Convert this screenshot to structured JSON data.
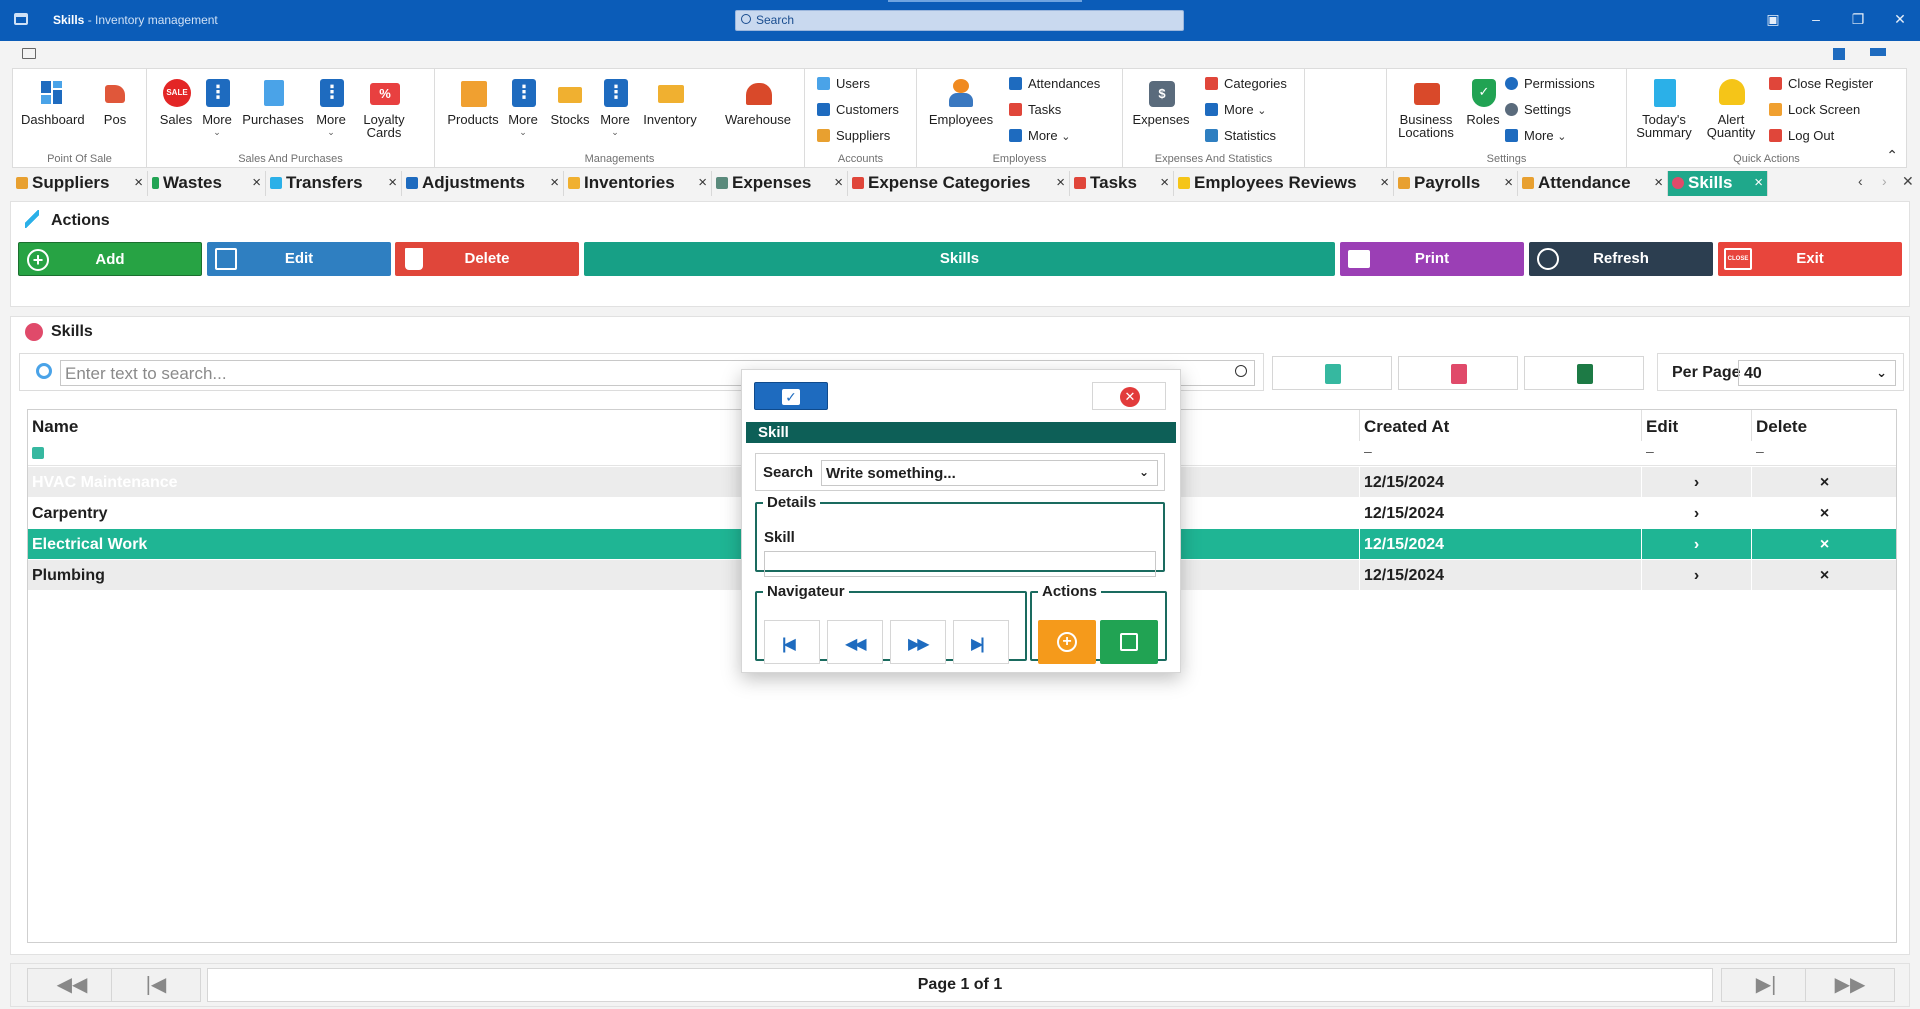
{
  "window": {
    "app_title": "Skills",
    "subtitle": " - Inventory management",
    "search_placeholder": "Search"
  },
  "ribbon": {
    "groups": [
      {
        "label": "Point Of Sale",
        "buttons": [
          "Dashboard",
          "Pos"
        ]
      },
      {
        "label": "Sales And Purchases",
        "buttons": [
          "Sales",
          "More",
          "Purchases",
          "More",
          "Loyalty Cards"
        ]
      },
      {
        "label": "Managements",
        "buttons": [
          "Products",
          "More",
          "Stocks",
          "More",
          "Inventory",
          "Warehouse"
        ]
      },
      {
        "label": "Accounts",
        "small": [
          "Users",
          "Customers",
          "Suppliers"
        ]
      },
      {
        "label": "Employess",
        "buttons": [
          "Employees"
        ],
        "small": [
          "Attendances",
          "Tasks",
          "More"
        ]
      },
      {
        "label": "Expenses And Statistics",
        "buttons": [
          "Expenses"
        ],
        "small": [
          "Categories",
          "More",
          "Statistics"
        ]
      },
      {
        "label": "Settings",
        "buttons": [
          "Business Locations",
          "Roles"
        ],
        "small": [
          "Permissions",
          "Settings",
          "More"
        ]
      },
      {
        "label": "Quick Actions",
        "buttons": [
          "Today's Summary",
          "Alert Quantity"
        ],
        "small": [
          "Close Register",
          "Lock Screen",
          "Log Out"
        ]
      }
    ],
    "sale_badge": "SALE",
    "loyalty_badge": "%"
  },
  "tabs": [
    "Suppliers",
    "Wastes",
    "Transfers",
    "Adjustments",
    "Inventories",
    "Expenses",
    "Expense Categories",
    "Tasks",
    "Employees Reviews",
    "Payrolls",
    "Attendance",
    "Skills"
  ],
  "tab_close": "×",
  "actions": {
    "title": "Actions",
    "add": "Add",
    "edit": "Edit",
    "delete": "Delete",
    "skills": "Skills",
    "print": "Print",
    "refresh": "Refresh",
    "exit": "Exit",
    "exit_badge": "CLOSE"
  },
  "list": {
    "title": "Skills",
    "search_placeholder": "Enter text to search...",
    "per_page_label": "Per Page",
    "per_page_value": "40",
    "columns": [
      "Name",
      "Created At",
      "Edit",
      "Delete"
    ],
    "filter_marks": [
      "–",
      "–",
      "–"
    ],
    "rows": [
      {
        "name": "HVAC Maintenance",
        "created": "12/15/2024",
        "edit": "›",
        "delete": "×"
      },
      {
        "name": "Carpentry",
        "created": "12/15/2024",
        "edit": "›",
        "delete": "×"
      },
      {
        "name": "Electrical Work",
        "created": "12/15/2024",
        "edit": "›",
        "delete": "×"
      },
      {
        "name": "Plumbing",
        "created": "12/15/2024",
        "edit": "›",
        "delete": "×"
      }
    ]
  },
  "pager": {
    "label": "Page 1 of 1"
  },
  "dialog": {
    "title": "Skill",
    "search_label": "Search",
    "search_value": "Write something...",
    "details_legend": "Details",
    "skill_label": "Skill",
    "skill_value": "",
    "nav_legend": "Navigateur",
    "actions_legend": "Actions"
  },
  "colors": {
    "titlebar": "#0b5cb8",
    "accent_teal": "#1fa88b",
    "add": "#27a344",
    "edit": "#2f7fc1",
    "delete": "#e0463a",
    "skills": "#17a086",
    "print": "#9b3fb5",
    "refresh": "#2c3e50",
    "exit": "#e8453c"
  }
}
